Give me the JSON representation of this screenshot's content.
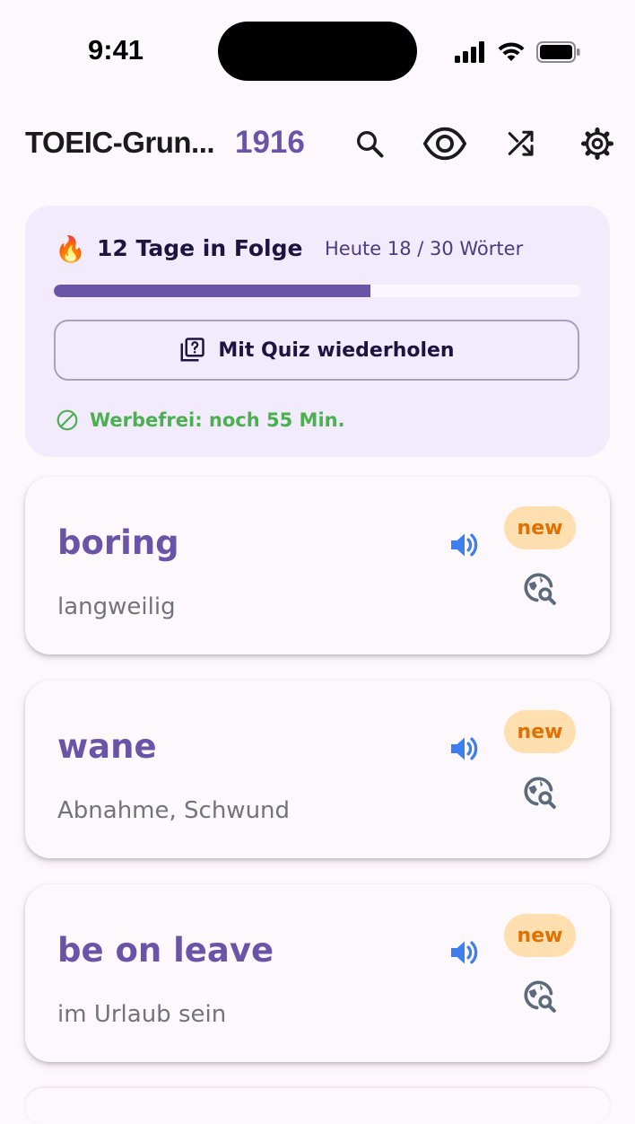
{
  "status_bar": {
    "time": "9:41"
  },
  "app_bar": {
    "title": "TOEIC-Grun...",
    "count": "1916",
    "icons": [
      "search-icon",
      "eye-icon",
      "shuffle-icon",
      "gear-icon"
    ]
  },
  "streak": {
    "emoji": "🔥",
    "label": "12 Tage in Folge",
    "today": "Heute 18 / 30 Wörter",
    "progress_fraction": 0.6,
    "quiz_button": "Mit Quiz wiederholen",
    "ad_free": "Werbefrei: noch 55 Min."
  },
  "words": [
    {
      "word": "boring",
      "meaning": "langweilig",
      "badge": "new"
    },
    {
      "word": "wane",
      "meaning": "Abnahme, Schwund",
      "badge": "new"
    },
    {
      "word": "be on leave",
      "meaning": "im Urlaub sein",
      "badge": "new"
    }
  ],
  "colors": {
    "accent": "#6a54a8",
    "card_bg": "#f1ebfc",
    "badge_bg": "#ffdfb0",
    "badge_text": "#e07000",
    "speaker": "#3d7ff0",
    "success": "#4caf50"
  }
}
